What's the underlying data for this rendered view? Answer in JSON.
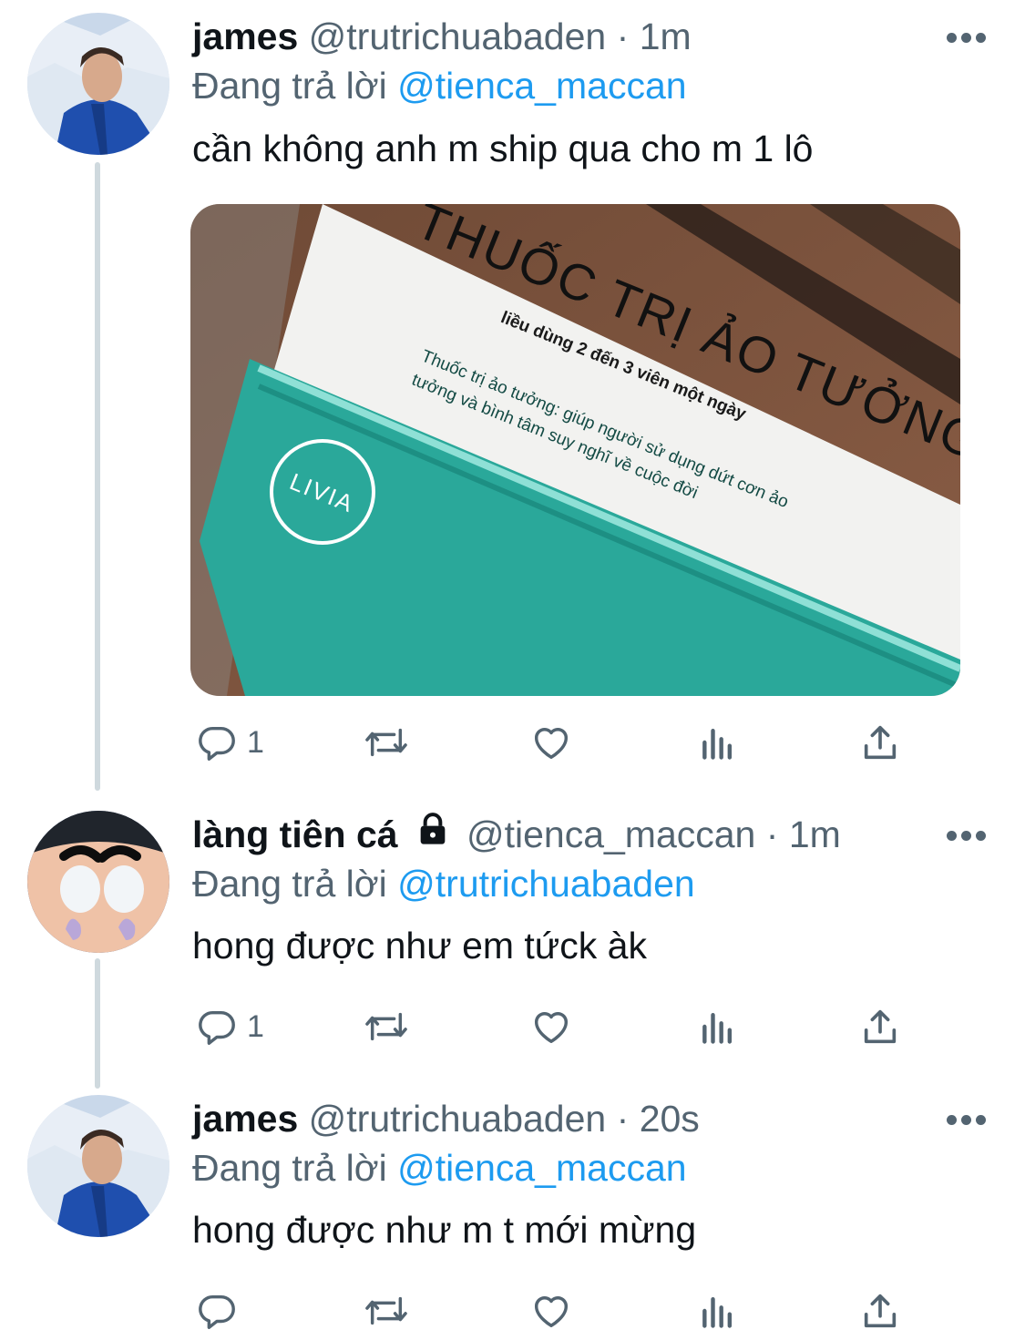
{
  "colors": {
    "text": "#0f1419",
    "secondary": "#536471",
    "accent": "#1d9bf0",
    "thread_line": "#cfd9de"
  },
  "tweets": [
    {
      "name": "james",
      "handle": "@trutrichuabaden",
      "separator": "·",
      "time": "1m",
      "reply_prefix": "Đang trả lời",
      "reply_mention": "@tienca_maccan",
      "text": "cần không anh m ship qua cho m 1 lô",
      "locked": false,
      "reply_count": "1",
      "avatar_icon": "person-photo-avatar",
      "media": {
        "box_title": "THUỐC TRỊ ẢO TƯỞNG",
        "box_dosage": "liều dùng 2 đến 3 viên một ngày",
        "box_brand": "LIVIA",
        "box_desc_line1": "Thuốc trị ảo tưởng: giúp người sử dụng dứt cơn ảo",
        "box_desc_line2": "tưởng và bình tâm suy nghĩ về cuộc đời"
      }
    },
    {
      "name": "làng tiên cá",
      "handle": "@tienca_maccan",
      "separator": "·",
      "time": "1m",
      "reply_prefix": "Đang trả lời",
      "reply_mention": "@trutrichuabaden",
      "text": "hong được như em tứck àk",
      "locked": true,
      "reply_count": "1",
      "avatar_icon": "cartoon-avatar"
    },
    {
      "name": "james",
      "handle": "@trutrichuabaden",
      "separator": "·",
      "time": "20s",
      "reply_prefix": "Đang trả lời",
      "reply_mention": "@tienca_maccan",
      "text": "hong được như m t mới mừng",
      "locked": false,
      "reply_count": "",
      "avatar_icon": "person-photo-avatar"
    }
  ],
  "icons": {
    "reply": "reply-icon",
    "retweet": "retweet-icon",
    "like": "heart-icon",
    "analytics": "analytics-icon",
    "share": "share-icon",
    "more": "more-icon",
    "lock": "lock-icon"
  }
}
